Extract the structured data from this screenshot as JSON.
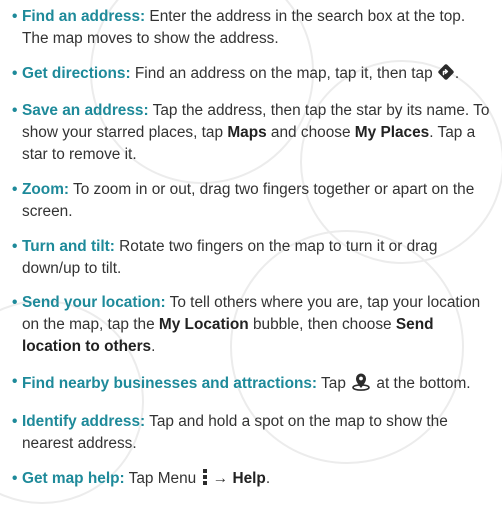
{
  "tips": [
    {
      "term": "Find an address:",
      "text": " Enter the address in the search box at the top. The map moves to show the address."
    },
    {
      "term": "Get directions:",
      "text": " Find an address on the map, tap it, then tap ",
      "icon": "directions-icon",
      "after": "."
    },
    {
      "term": "Save an address:",
      "t1": " Tap the address, then tap the star by its name. To show your starred places, tap ",
      "b1": "Maps",
      "t2": " and choose ",
      "b2": "My Places",
      "t3": ". Tap a star to remove it."
    },
    {
      "term": "Zoom:",
      "text": " To zoom in or out, drag two fingers together or apart on the screen."
    },
    {
      "term": "Turn and tilt:",
      "text": " Rotate two fingers on the map to turn it or drag down/up to tilt."
    },
    {
      "term": "Send your location:",
      "t1": " To tell others where you are, tap your location on the map, tap the ",
      "b1": "My Location",
      "t2": " bubble, then choose ",
      "b2": "Send location to others",
      "t3": "."
    },
    {
      "term": "Find nearby businesses and attractions:",
      "text": " Tap ",
      "icon": "location-pin-icon",
      "after": " at the bottom."
    },
    {
      "term": "Identify address:",
      "text": " Tap and hold a spot on the map to show the nearest address."
    },
    {
      "term": "Get map help:",
      "text": " Tap Menu ",
      "icon": "menu-dots-icon",
      "arrow": " → ",
      "b1": "Help",
      "after": "."
    }
  ],
  "icons": {
    "directions": "directions-icon",
    "pin": "location-pin-icon",
    "menu": "menu-dots-icon"
  },
  "colors": {
    "term": "#1e8a9a",
    "text": "#333333"
  }
}
